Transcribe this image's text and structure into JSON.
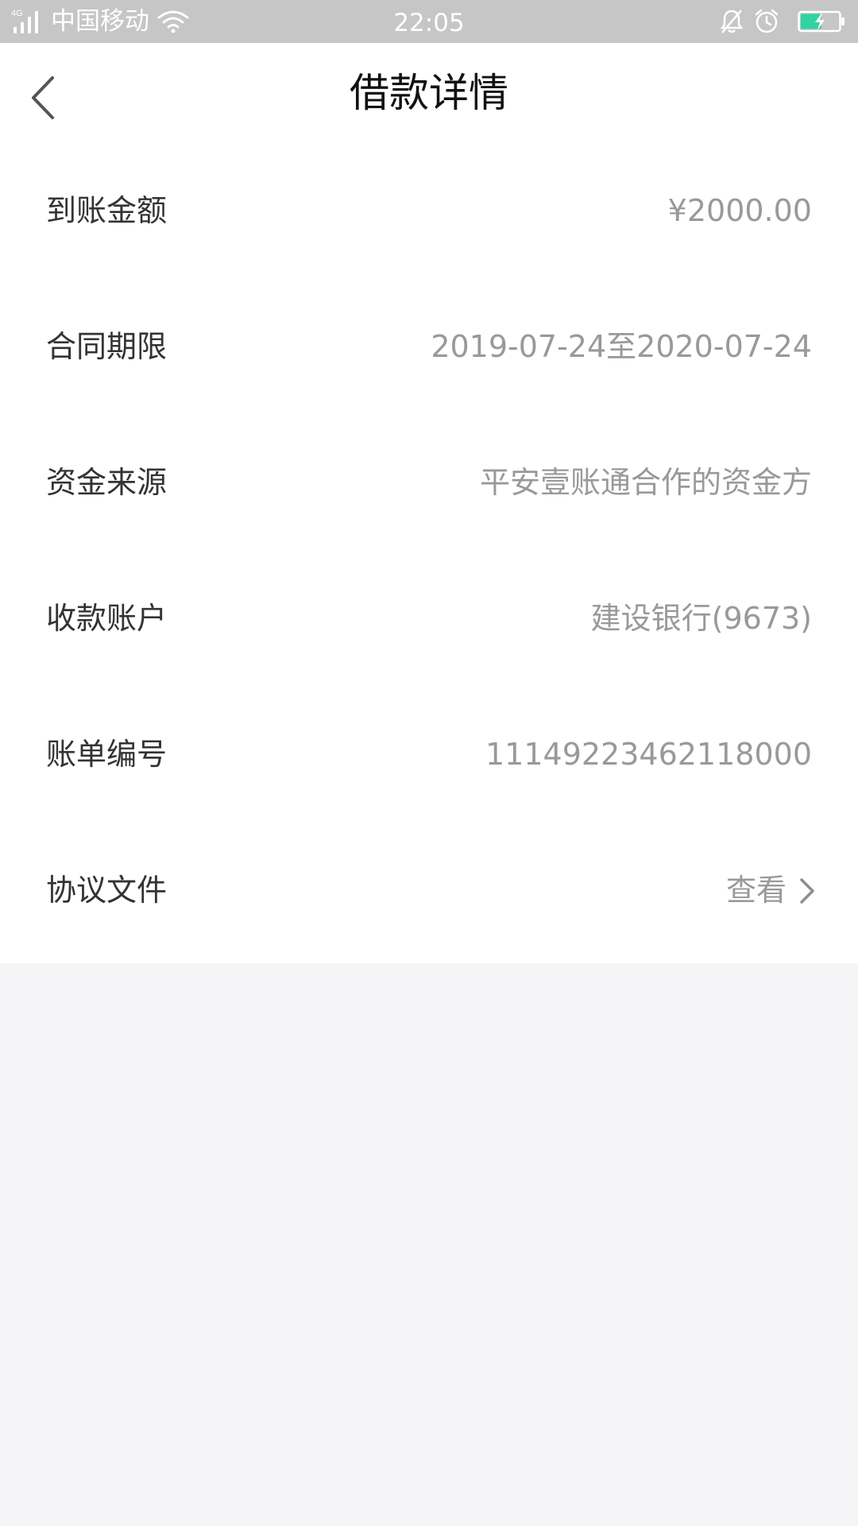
{
  "status_bar": {
    "network": "4G",
    "carrier": "中国移动",
    "time": "22:05",
    "icons": [
      "signal-icon",
      "wifi-icon",
      "mute-bell-icon",
      "alarm-icon",
      "battery-charging-icon"
    ],
    "battery_color": "#2fd3a4"
  },
  "header": {
    "title": "借款详情",
    "back_icon": "chevron-left-icon"
  },
  "details": [
    {
      "label": "到账金额",
      "value": "¥2000.00"
    },
    {
      "label": "合同期限",
      "value": "2019-07-24至2020-07-24"
    },
    {
      "label": "资金来源",
      "value": "平安壹账通合作的资金方"
    },
    {
      "label": "收款账户",
      "value": "建设银行(9673)"
    },
    {
      "label": "账单编号",
      "value": "11149223462118000"
    },
    {
      "label": "协议文件",
      "value": "查看",
      "icon": "chevron-right-icon"
    }
  ],
  "colors": {
    "label": "#333333",
    "value": "#999999",
    "page_background": "#f5f5f7",
    "status_bar": "#c6c6c6"
  }
}
